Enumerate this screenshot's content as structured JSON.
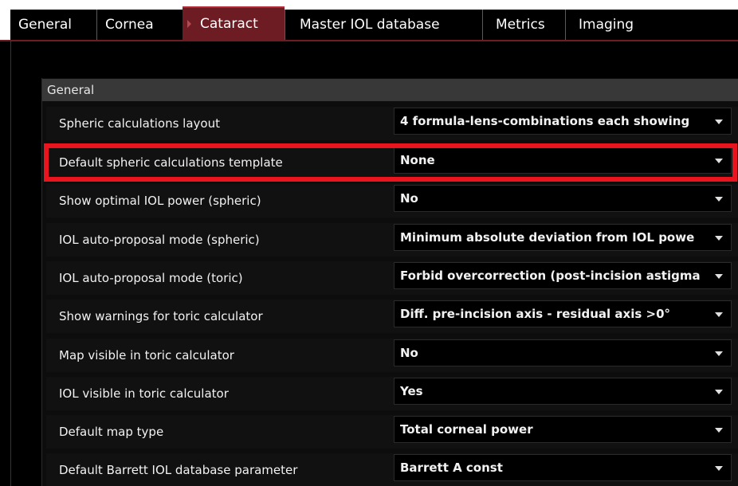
{
  "tabs": [
    "General",
    "Cornea",
    "Cataract",
    "Master IOL database",
    "Metrics",
    "Imaging"
  ],
  "active_tab": "Cataract",
  "section": {
    "title": "General"
  },
  "settings": [
    {
      "label": "Spheric calculations layout",
      "value": "4 formula-lens-combinations each showing"
    },
    {
      "label": "Default spheric calculations template",
      "value": "None"
    },
    {
      "label": "Show optimal IOL power (spheric)",
      "value": "No"
    },
    {
      "label": "IOL auto-proposal mode (spheric)",
      "value": "Minimum absolute deviation from IOL powe"
    },
    {
      "label": "IOL auto-proposal mode (toric)",
      "value": "Forbid overcorrection (post-incision astigma"
    },
    {
      "label": "Show warnings for toric calculator",
      "value": "Diff. pre-incision axis - residual axis >0°"
    },
    {
      "label": "Map visible in toric calculator",
      "value": "No"
    },
    {
      "label": "IOL visible in toric calculator",
      "value": "Yes"
    },
    {
      "label": "Default map type",
      "value": "Total corneal power"
    },
    {
      "label": "Default Barrett IOL database parameter",
      "value": "Barrett A const"
    }
  ],
  "highlighted_setting": "Default spheric calculations template",
  "colors": {
    "active_tab": "#6e1c23",
    "background": "#000000",
    "highlight": "#e8141e",
    "section_header": "#383838"
  }
}
